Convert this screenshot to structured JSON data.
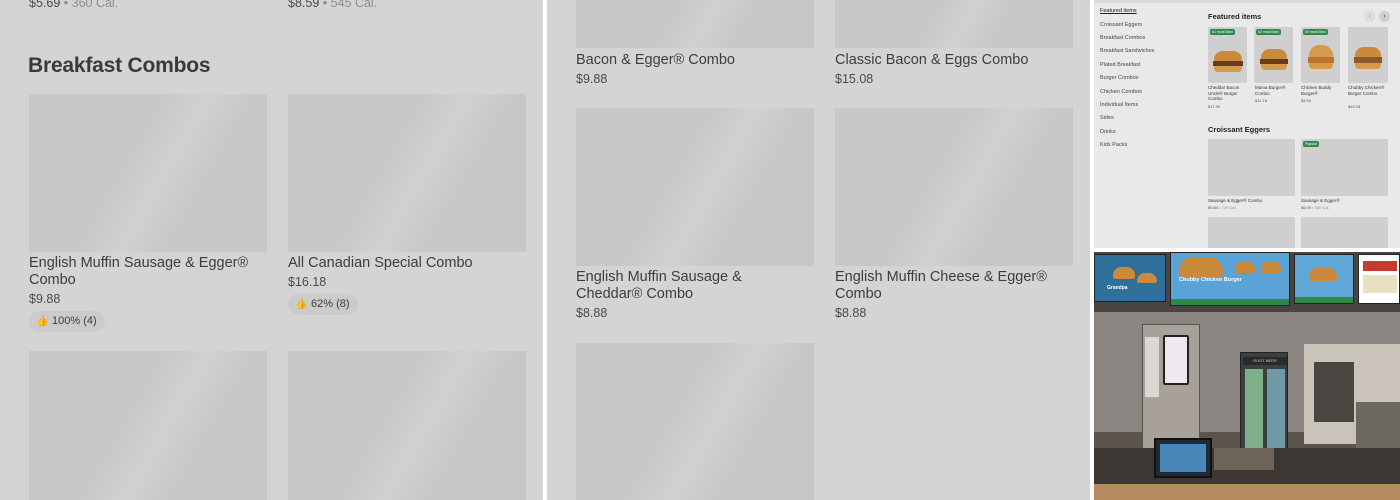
{
  "panel1": {
    "top_prices": [
      {
        "price": "$5.69",
        "cal": "360 Cal."
      },
      {
        "price": "$8.59",
        "cal": "545 Cal."
      }
    ],
    "section_title": "Breakfast Combos",
    "items": [
      {
        "name": "English Muffin Sausage & Egger® Combo",
        "price": "$9.88",
        "rating": "100% (4)"
      },
      {
        "name": "All Canadian Special Combo",
        "price": "$16.18",
        "rating": "62% (8)"
      }
    ]
  },
  "panel2": {
    "items": [
      {
        "name": "Bacon & Egger® Combo",
        "price": "$9.88"
      },
      {
        "name": "Classic Bacon & Eggs Combo",
        "price": "$15.08"
      },
      {
        "name": "English Muffin Sausage & Cheddar® Combo",
        "price": "$8.88"
      },
      {
        "name": "English Muffin Cheese & Egger® Combo",
        "price": "$8.88"
      }
    ]
  },
  "panel3": {
    "nav": [
      "Featured items",
      "Croissant Eggers",
      "Breakfast Combos",
      "Breakfast Sandwiches",
      "Plated Breakfast",
      "Burger Combos",
      "Chicken Combos",
      "Individual Items",
      "Sides",
      "Drinks",
      "Kids Packs"
    ],
    "featured_title": "Featured items",
    "featured": [
      {
        "name": "Cheddar Bacon Uncle® Burger Combo",
        "price": "$17.99",
        "badge": "#1 most liked"
      },
      {
        "name": "Mama Burger® Combo",
        "price": "$11.18",
        "badge": "#2 most liked"
      },
      {
        "name": "Chicken Buddy Burger®",
        "price": "$3.99",
        "badge": "#3 most liked"
      },
      {
        "name": "Chubby Chicken® Burger Combo",
        "price": "$15.18",
        "badge": ""
      }
    ],
    "croissant_title": "Croissant Eggers",
    "croissant": [
      {
        "name": "Sausage & Egger® Combo",
        "price": "$9.84",
        "cal": "725 Cal."
      },
      {
        "name": "Sausage & Egger®",
        "price": "$6.09",
        "cal": "380 Cal.",
        "badge": "Popular"
      }
    ],
    "prev_icon": "chevron-left-icon",
    "next_icon": "chevron-right-icon"
  },
  "panel4": {
    "menu_boards": [
      "Chubby Chicken Burger",
      "Grandpa"
    ],
    "fridge_label": "ROOT BEER",
    "accent": "#2f8a4a"
  }
}
